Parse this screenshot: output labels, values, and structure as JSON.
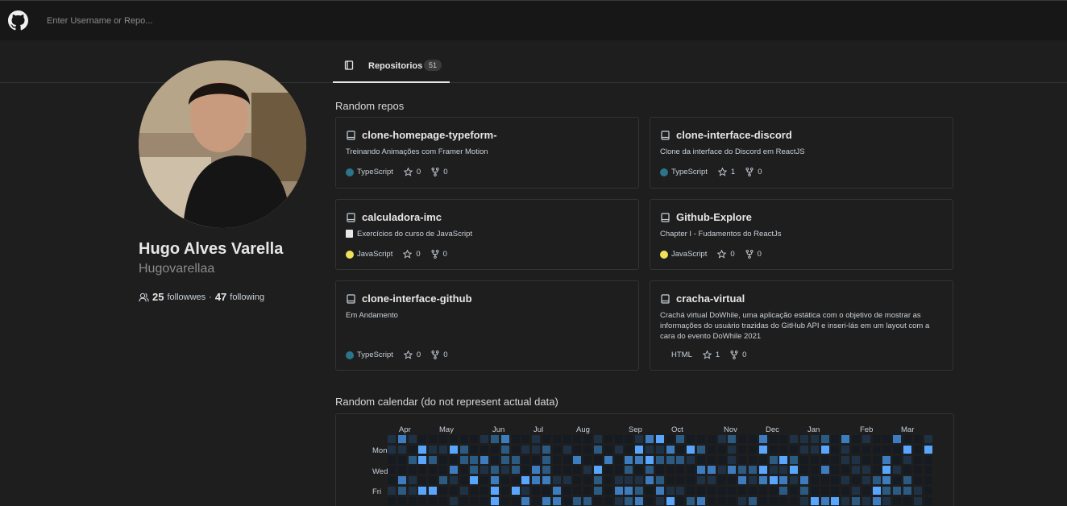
{
  "search": {
    "placeholder": "Enter Username or Repo..."
  },
  "tab": {
    "label": "Repositorios",
    "count": "51"
  },
  "profile": {
    "name": "Hugo Alves Varella",
    "login": "Hugovarellaa",
    "followers_count": "25",
    "followers_label": "followwes",
    "separator": "·",
    "following_count": "47",
    "following_label": "following"
  },
  "repos_title": "Random repos",
  "repos": [
    {
      "name": "clone-homepage-typeform-",
      "description": "Treinando Animações com Framer Motion",
      "language": "TypeScript",
      "lang_color": "#2b7489",
      "stars": "0",
      "forks": "0"
    },
    {
      "name": "clone-interface-discord",
      "description": "Clone da interface do Discord em ReactJS",
      "language": "TypeScript",
      "lang_color": "#2b7489",
      "stars": "1",
      "forks": "0"
    },
    {
      "name": "calculadora-imc",
      "description": "Exercícios do curso de JavaScript",
      "language": "JavaScript",
      "lang_color": "#f1e05a",
      "stars": "0",
      "forks": "0"
    },
    {
      "name": "Github-Explore",
      "description": "Chapter I - Fudamentos do ReactJs",
      "language": "JavaScript",
      "lang_color": "#f1e05a",
      "stars": "0",
      "forks": "0"
    },
    {
      "name": "clone-interface-github",
      "description": "Em Andamento",
      "language": "TypeScript",
      "lang_color": "#2b7489",
      "stars": "0",
      "forks": "0"
    },
    {
      "name": "cracha-virtual",
      "description": "Crachá virtual DoWhile, uma aplicação estática com o objetivo de mostrar as informações do usuário trazidas do GitHub API e inseri-lás em um layout com a cara do evento DoWhile 2021",
      "language": "HTML",
      "lang_color": "",
      "stars": "1",
      "forks": "0"
    }
  ],
  "calendar": {
    "title": "Random calendar (do not represent actual data)",
    "months": [
      "Apr",
      "May",
      "Jun",
      "Jul",
      "Aug",
      "Sep",
      "Oct",
      "Nov",
      "Dec",
      "Jan",
      "Feb",
      "Mar"
    ],
    "days": [
      "Mon",
      "Wed",
      "Fri"
    ],
    "colors": [
      "#161b22",
      "#1f3245",
      "#2b5a82",
      "#3d7cbf",
      "#58a6ff"
    ]
  }
}
